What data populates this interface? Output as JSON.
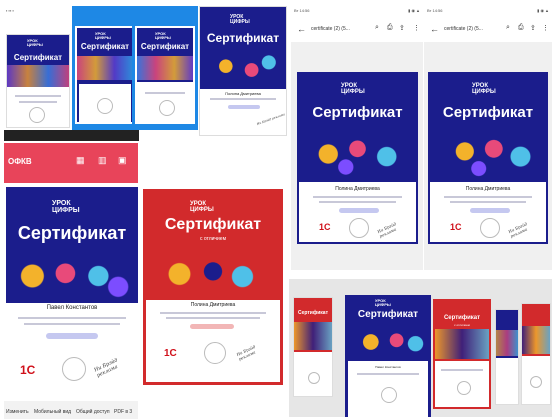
{
  "cert": {
    "logo": "УРОК\nЦИФРЫ",
    "title": "Сертификат",
    "subtitle": "с отличием",
    "names": [
      "Павел Константов",
      "Полина Дмитриева"
    ],
    "sig": "Ни Брэйд реклама"
  },
  "logos": {
    "onec": "1С"
  },
  "pdf": {
    "file": "certificate (2) (5...",
    "time_a": "Вт 14:56",
    "time_b": "Вт 14:56"
  },
  "share": {
    "app": "ОФКВ",
    "actions": [
      "Изменить",
      "Мобильный вид",
      "Общий доступ",
      "PDF в 3"
    ]
  },
  "colors": {
    "blue": "#1b1d8c",
    "red": "#d22a2c",
    "accent": "#e8445a"
  }
}
